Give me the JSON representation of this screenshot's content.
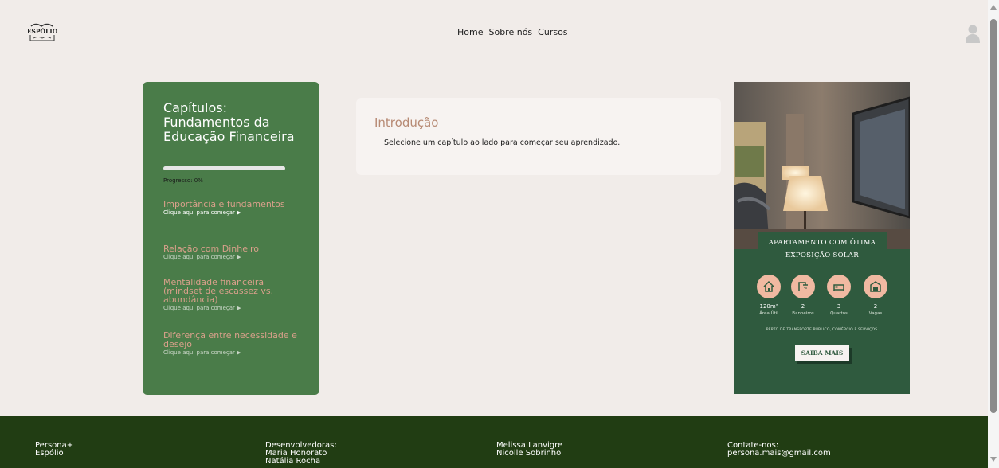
{
  "header": {
    "logo_text": "ESPÓLIO",
    "nav": [
      "Home",
      "Sobre nós",
      "Cursos"
    ]
  },
  "sidebar": {
    "title": "Capítulos: Fundamentos da Educação Financeira",
    "progress_text": "Progresso: 0%",
    "progress_value": 0,
    "chapters": [
      {
        "title": "Importância e fundamentos",
        "action": "Clique aqui para começar ▶"
      },
      {
        "title": "Relação com Dinheiro",
        "action": "Clique aqui para começar ▶"
      },
      {
        "title": "Mentalidade financeira (mindset de escassez vs. abundância)",
        "action": "Clique aqui para começar ▶"
      },
      {
        "title": "Diferença entre necessidade e desejo",
        "action": "Clique aqui para começar ▶"
      }
    ]
  },
  "main": {
    "title": "Introdução",
    "text": "Selecione um capítulo ao lado para começar seu aprendizado."
  },
  "ad": {
    "headline": "APARTAMENTO COM ÓTIMA EXPOSIÇÃO SOLAR",
    "features": [
      {
        "icon": "house-icon",
        "value": "120m²",
        "label": "Área Útil"
      },
      {
        "icon": "shower-icon",
        "value": "2",
        "label": "Banheiros"
      },
      {
        "icon": "bed-icon",
        "value": "3",
        "label": "Quartos"
      },
      {
        "icon": "garage-icon",
        "value": "2",
        "label": "Vagas"
      }
    ],
    "footnote": "PERTO DE TRANSPORTE PÚBLICO, COMÉRCIO E SERVIÇOS",
    "button": "SAIBA MAIS"
  },
  "footer": {
    "col1": [
      "Persona+",
      "Espólio"
    ],
    "col2": [
      "Desenvolvedoras:",
      "Maria Honorato",
      "Natália Rocha"
    ],
    "col3": [
      "Melissa Lanvigre",
      "Nicolle Sobrinho"
    ],
    "col4": [
      "Contate-nos:",
      "persona.mais@gmail.com"
    ]
  },
  "colors": {
    "background": "#f1ece9",
    "sidebar": "#4a7c49",
    "chapter_title": "#d9a08b",
    "footer": "#213d13",
    "ad_green": "#2f5a3e",
    "ad_peach": "#f0b9a1"
  }
}
